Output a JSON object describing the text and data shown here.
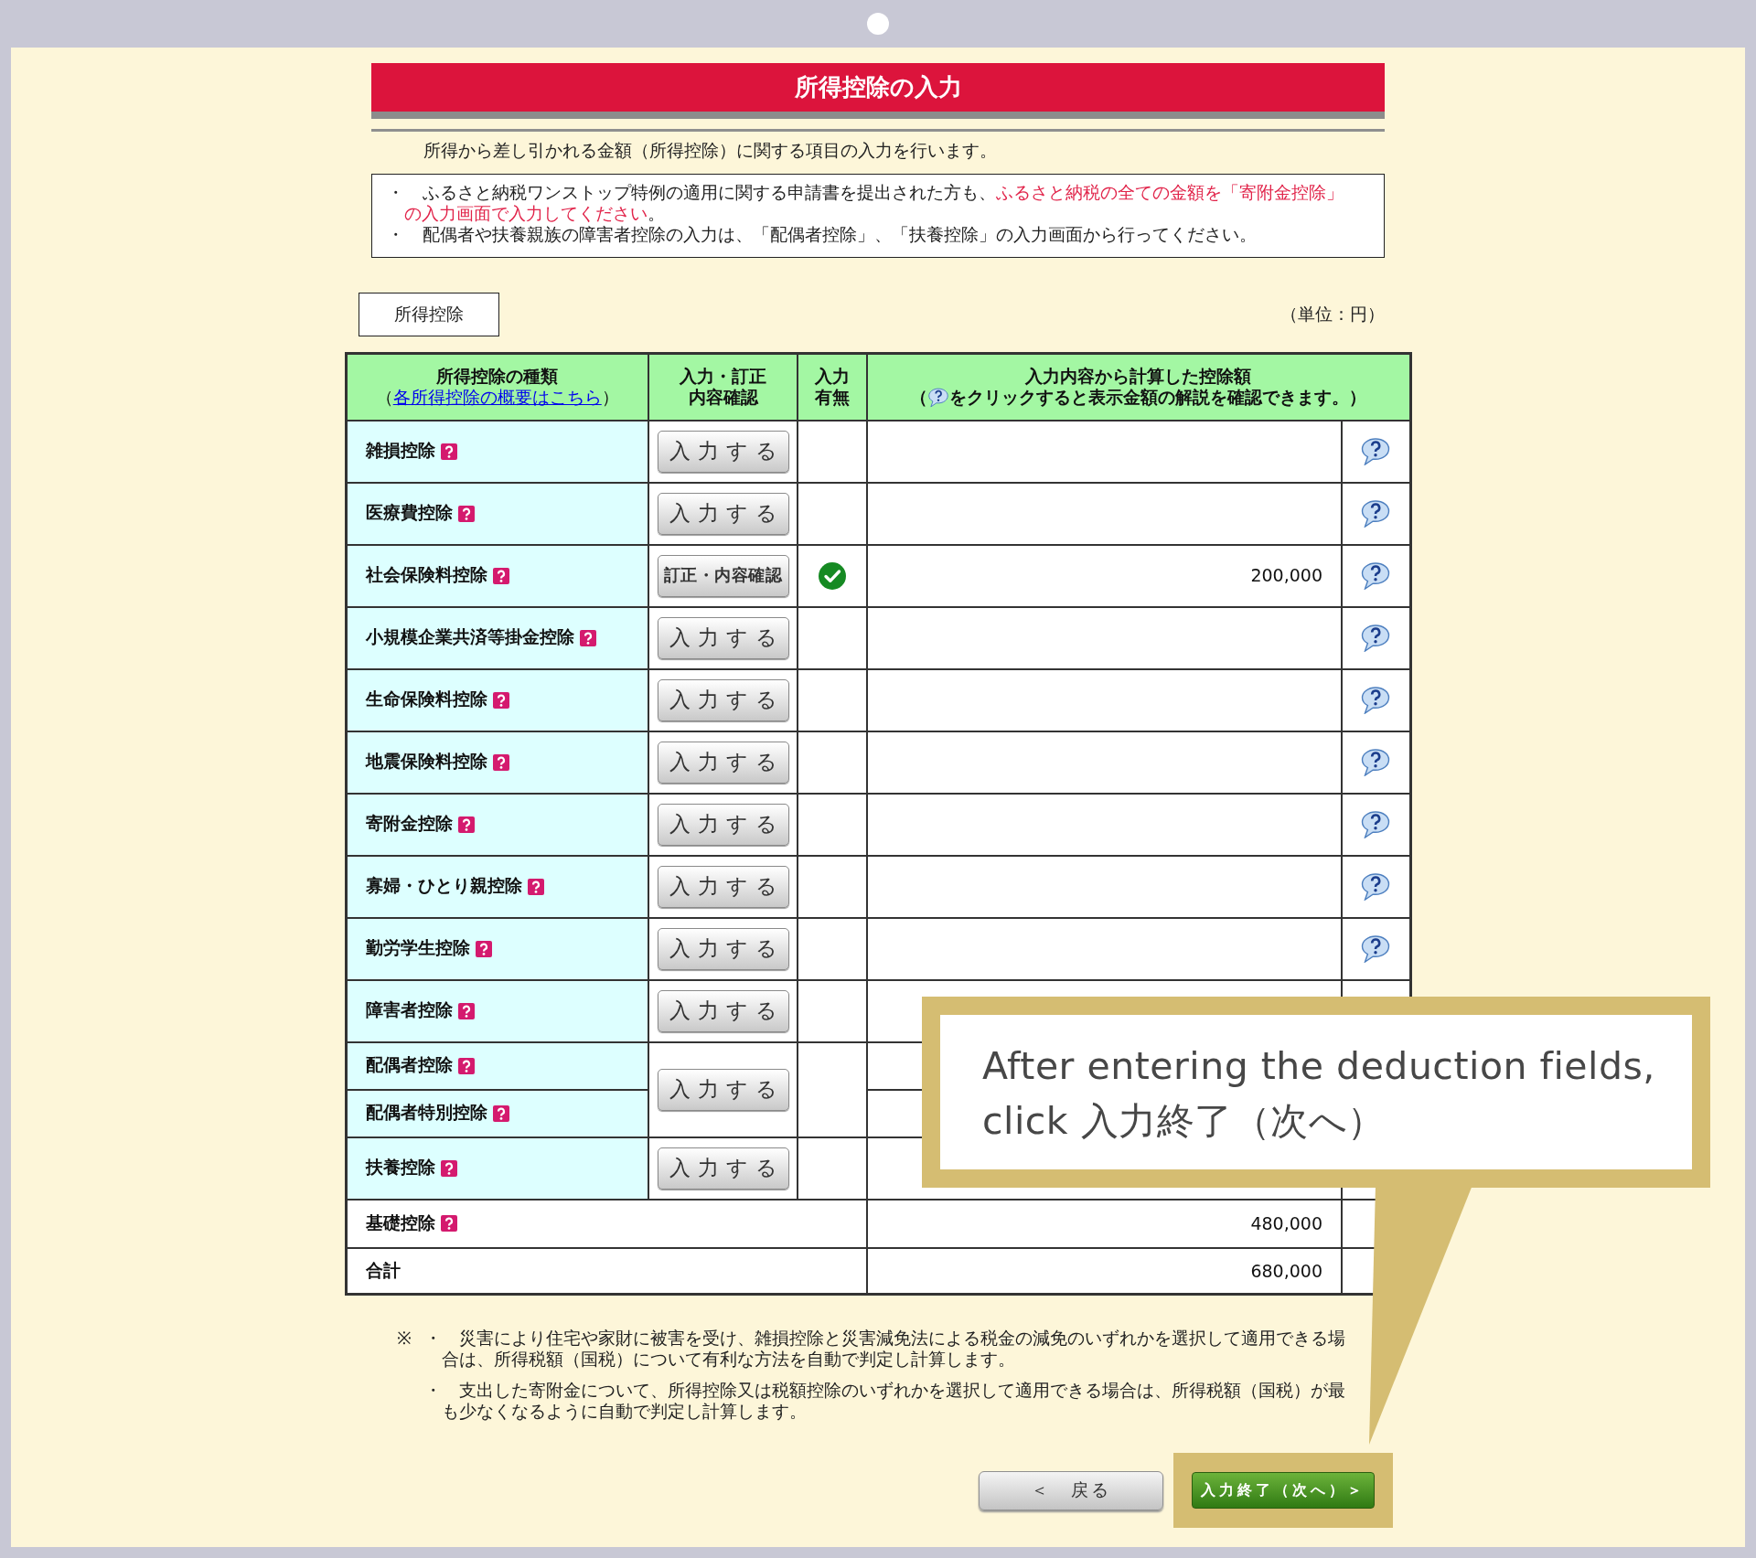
{
  "page": {
    "title": "所得控除の入力",
    "intro": "所得から差し引かれる金額（所得控除）に関する項目の入力を行います。"
  },
  "notices": [
    {
      "bullet": "・",
      "segments": [
        {
          "text": "ふるさと納税ワンストップ特例の適用に関する申請書を提出された方も、",
          "emphasis": false
        },
        {
          "text": "ふるさと納税の全ての金額を「寄附金控除」の入力画面で入力してください",
          "emphasis": true
        },
        {
          "text": "。",
          "emphasis": false
        }
      ]
    },
    {
      "bullet": "・",
      "segments": [
        {
          "text": "配偶者や扶養親族の障害者控除の入力は、「配偶者控除」、「扶養控除」の入力画面から行ってください。",
          "emphasis": false
        }
      ]
    }
  ],
  "section": {
    "tab": "所得控除",
    "unit": "（単位：円）"
  },
  "table": {
    "header": {
      "type_column": {
        "title": "所得控除の種類",
        "note_prefix": "（",
        "link": "各所得控除の概要はこちら",
        "note_suffix": "）"
      },
      "input_column": [
        "入力・訂正",
        "内容確認"
      ],
      "status_column": [
        "入力",
        "有無"
      ],
      "amount_column": {
        "title": "入力内容から計算した控除額",
        "note_prefix": "（",
        "note_suffix": "をクリックすると表示金額の解説を確認できます。）"
      }
    },
    "rows": [
      {
        "kind": "deduction",
        "label": "雑損控除",
        "button": "入力する",
        "entered": false,
        "explain_icon": true
      },
      {
        "kind": "deduction",
        "label": "医療費控除",
        "button": "入力する",
        "entered": false,
        "explain_icon": true
      },
      {
        "kind": "deduction",
        "label": "社会保険料控除",
        "button": "訂正・内容確認",
        "entered": true,
        "amount": "200,000",
        "explain_icon": true
      },
      {
        "kind": "deduction",
        "label": "小規模企業共済等掛金控除",
        "button": "入力する",
        "entered": false,
        "explain_icon": true
      },
      {
        "kind": "deduction",
        "label": "生命保険料控除",
        "button": "入力する",
        "entered": false,
        "explain_icon": true
      },
      {
        "kind": "deduction",
        "label": "地震保険料控除",
        "button": "入力する",
        "entered": false,
        "explain_icon": true
      },
      {
        "kind": "deduction",
        "label": "寄附金控除",
        "button": "入力する",
        "entered": false,
        "explain_icon": true
      },
      {
        "kind": "deduction",
        "label": "寡婦・ひとり親控除",
        "button": "入力する",
        "entered": false,
        "explain_icon": true
      },
      {
        "kind": "deduction",
        "label": "勤労学生控除",
        "button": "入力する",
        "entered": false,
        "explain_icon": true
      },
      {
        "kind": "deduction",
        "label": "障害者控除",
        "button": "入力する",
        "entered": false,
        "explain_icon": false
      },
      {
        "kind": "pair",
        "labels": [
          "配偶者控除",
          "配偶者特別控除"
        ],
        "button": "入力する",
        "entered": false
      },
      {
        "kind": "deduction",
        "label": "扶養控除",
        "button": "入力する",
        "entered": false,
        "explain_icon": false
      },
      {
        "kind": "basic",
        "label": "基礎控除",
        "amount": "480,000"
      },
      {
        "kind": "total",
        "label": "合計",
        "amount": "680,000"
      }
    ]
  },
  "footnotes": {
    "mark": "※",
    "items": [
      {
        "bullet": "・",
        "text": "災害により住宅や家財に被害を受け、雑損控除と災害減免法による税金の減免のいずれかを選択して適用できる場合は、所得税額（国税）について有利な方法を自動で判定し計算します。"
      },
      {
        "bullet": "・",
        "text": "支出した寄附金について、所得控除又は税額控除のいずれかを選択して適用できる場合は、所得税額（国税）が最も少なくなるように自動で判定し計算します。"
      }
    ]
  },
  "buttons": [
    {
      "kind": "back",
      "label": "＜　戻る",
      "highlighted": false
    },
    {
      "kind": "next",
      "label": "入力終了（次へ）＞",
      "highlighted": true
    }
  ],
  "callout": {
    "text": "After entering the deduction fields, click 入力終了（次へ）"
  }
}
